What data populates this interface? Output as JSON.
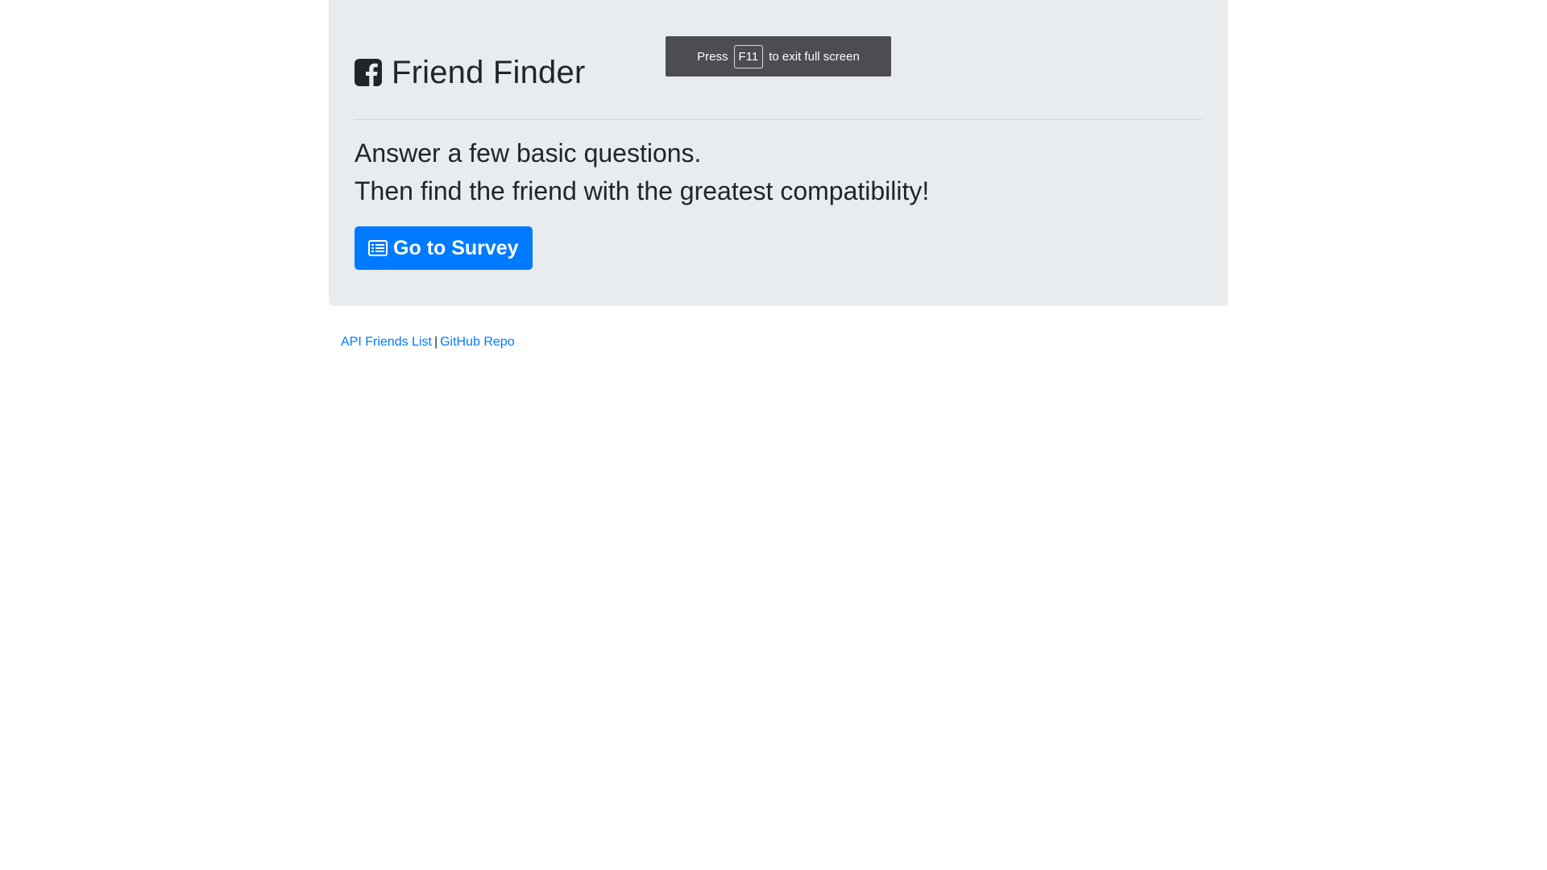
{
  "header": {
    "title": "Friend Finder",
    "icon": "facebook-square-icon"
  },
  "main": {
    "lead_line_1": "Answer a few basic questions.",
    "lead_line_2": "Then find the friend with the greatest compatibility!",
    "survey_button": {
      "label": "Go to Survey",
      "icon": "list-alt-icon"
    }
  },
  "footer": {
    "links": [
      {
        "label": "API Friends List"
      },
      {
        "label": "GitHub Repo"
      }
    ],
    "separator": "|"
  },
  "fullscreen_notice": {
    "prefix": "Press",
    "key": "F11",
    "suffix": "to exit full screen"
  },
  "colors": {
    "jumbotron_bg": "#e9ecef",
    "primary": "#007bff",
    "text": "#212529",
    "toast_bg": "#4b4d51"
  }
}
